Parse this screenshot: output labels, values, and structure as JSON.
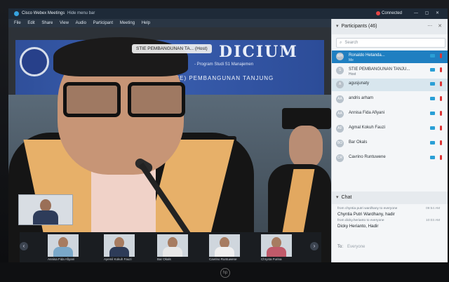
{
  "window": {
    "title": "Cisco Webex Meetings",
    "menu_toggle": "Hide menu bar",
    "connection": "Connected",
    "controls": "— ▢ ✕"
  },
  "menu": [
    "File",
    "Edit",
    "Share",
    "View",
    "Audio",
    "Participant",
    "Meeting",
    "Help"
  ],
  "video": {
    "host_tag": "STIE PEMBANGUNAN TA... (Host)",
    "banner_title": "DICIUM",
    "banner_sub1": "- Program Studi S1 Manajemen",
    "banner_sub2": "(STIE) PEMBANGUNAN TANJUNG"
  },
  "filmstrip": {
    "names": [
      "Annisa Fida Afiyani",
      "Ayemil Kokuh Fauzi",
      "Bar Okals",
      "Cavrino Runtuwene",
      "Chrysta Furina"
    ],
    "prev": "‹",
    "next": "›"
  },
  "participants": {
    "header": "Participants (46)",
    "search_placeholder": "Search",
    "list": [
      {
        "initials": "RH",
        "name": "Ronaldo Hetanda...",
        "role": "Me"
      },
      {
        "initials": "S",
        "name": "STIE PEMBANGUNAN TANJU...",
        "role": "Host"
      },
      {
        "initials": "A",
        "name": "agusjunaty",
        "role": ""
      },
      {
        "initials": "AA",
        "name": "andris arham",
        "role": ""
      },
      {
        "initials": "AA",
        "name": "Annisa Fida Afiyani",
        "role": ""
      },
      {
        "initials": "AF",
        "name": "Agmal Kokuh Fauzi",
        "role": ""
      },
      {
        "initials": "BO",
        "name": "Bar Okals",
        "role": ""
      },
      {
        "initials": "CR",
        "name": "Cavrino Runtuwene",
        "role": ""
      }
    ]
  },
  "chat": {
    "header": "Chat",
    "messages": [
      {
        "meta": "from chyntia putri wardhany to everyone",
        "time": "09:54 AM",
        "text": "Chyntia Putri Wardhany, hadir"
      },
      {
        "meta": "from dicky.herianto to everyone",
        "time": "10:03 AM",
        "text": "Dicky Herianto, Hadir"
      }
    ],
    "to_label": "To:",
    "to_value": "Everyone"
  }
}
